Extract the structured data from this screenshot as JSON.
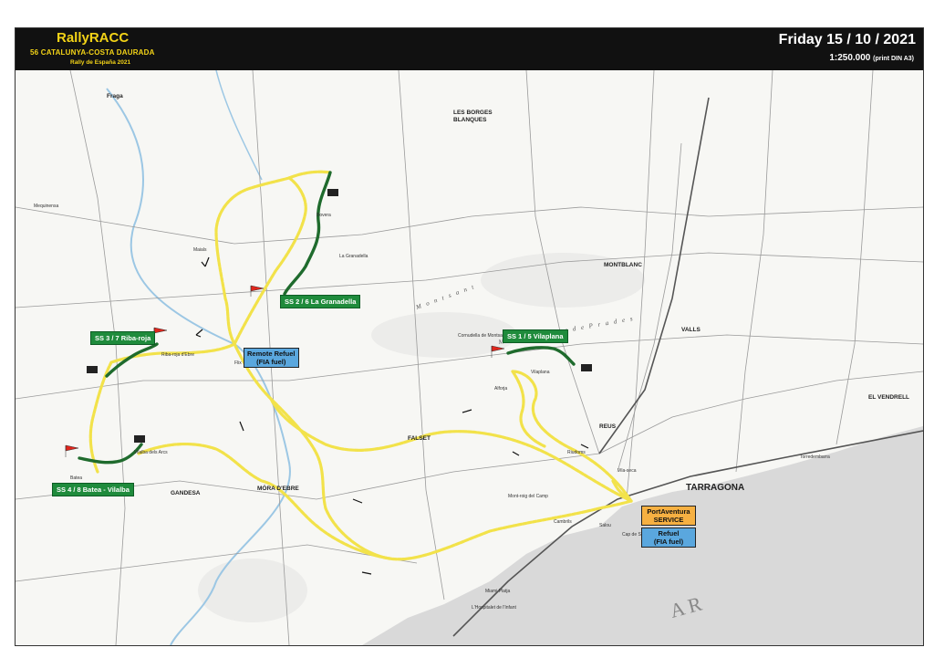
{
  "header": {
    "brand": "RallyRACC",
    "event": "56 CATALUNYA-COSTA DAURADA",
    "subtitle": "Rally de España 2021",
    "date": "Friday 15 / 10 / 2021",
    "scale": "1:250.000",
    "scale_note": "(print DIN A3)"
  },
  "colors": {
    "header_bg": "#111111",
    "brand": "#f3d317",
    "stage": "#1f8b3c",
    "liaison": "#f2e24a",
    "refuel": "#5aa7de",
    "service": "#f6b042",
    "flag_start": "#e0261c",
    "sea": "#d9d9d9"
  },
  "stages": [
    {
      "id": "ss1",
      "label": "SS 1 / 5 Vilaplana"
    },
    {
      "id": "ss2",
      "label": "SS 2 / 6 La Granadella"
    },
    {
      "id": "ss3",
      "label": "SS 3 / 7 Riba-roja"
    },
    {
      "id": "ss4",
      "label": "SS 4 / 8 Batea - Vilalba"
    }
  ],
  "boxes": {
    "remote_refuel": {
      "line1": "Remote Refuel",
      "line2": "(FIA fuel)"
    },
    "service": {
      "line1": "PortAventura",
      "line2": "SERVICE"
    },
    "refuel": {
      "line1": "Refuel",
      "line2": "(FIA fuel)"
    }
  },
  "places": {
    "tarragona": "TARRAGONA",
    "reus": "REUS",
    "valls": "VALLS",
    "montblanc": "MONTBLANC",
    "borges": "LES BORGES",
    "borges2": "BLANQUES",
    "mora": "MÓRA D'EBRE",
    "gandesa": "GANDESA",
    "falset": "FALSET",
    "cambrils": "Cambrils",
    "salou": "Salou",
    "vendrell": "EL VENDRELL",
    "fraga": "Fraga",
    "flix": "Flix",
    "granadella": "La Granadella",
    "vilaplana": "Vilaplana",
    "riba_roja": "Riba-roja d'Ebre",
    "batea": "Batea",
    "vilalba": "Vilalba dels Arcs",
    "mequinensa": "Mequinensa",
    "maials": "Maials",
    "bovera": "Bovera",
    "torredembarra": "Torredembarra",
    "hospitalet": "L'Hospitalet de l'Infant",
    "miami": "Miami Platja",
    "cornudella": "Cornudella de Montsant",
    "alforja": "Alforja",
    "mont_roig": "Mont-roig del Camp",
    "riudoms": "Riudoms",
    "vila_seca": "Vila-seca",
    "cap_salou": "Cap de Salou",
    "montsant": "M o n t s a n t",
    "prades": "M u n t a n y e s   d e   P r a d e s",
    "sea": "A   R"
  }
}
